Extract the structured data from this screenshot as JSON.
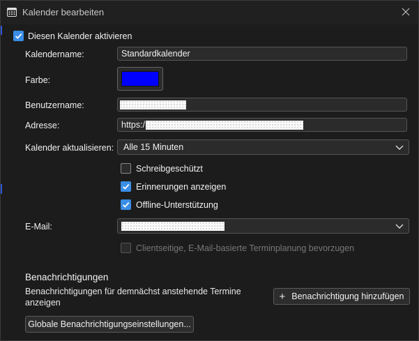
{
  "window": {
    "title": "Kalender bearbeiten",
    "calendar_icon": "calendar-icon",
    "close_icon": "close-icon"
  },
  "form": {
    "enable_label": "Diesen Kalender aktivieren",
    "enable_checked": true,
    "name_label": "Kalendername:",
    "name_value": "Standardkalender",
    "color_label": "Farbe:",
    "color_value": "#0000ff",
    "username_label": "Benutzername:",
    "address_label": "Adresse:",
    "address_prefix": "https:/",
    "refresh_label": "Kalender aktualisieren:",
    "refresh_value": "Alle 15 Minuten",
    "readonly_label": "Schreibgeschützt",
    "readonly_checked": false,
    "reminders_label": "Erinnerungen anzeigen",
    "reminders_checked": true,
    "offline_label": "Offline-Unterstützung",
    "offline_checked": true,
    "email_label": "E-Mail:",
    "client_scheduling_label": "Clientseitige, E-Mail-basierte Terminplanung bevorzugen",
    "client_scheduling_checked": false
  },
  "notifications": {
    "title": "Benachrichtigungen",
    "description": "Benachrichtigungen für demnächst anstehende Termine anzeigen",
    "add_button": "Benachrichtigung hinzufügen",
    "global_button": "Globale Benachrichtigungseinstellungen..."
  },
  "colors": {
    "accent": "#3a8ee6",
    "window_bg": "#1c1c1c",
    "field_bg": "#2b2b2b"
  }
}
